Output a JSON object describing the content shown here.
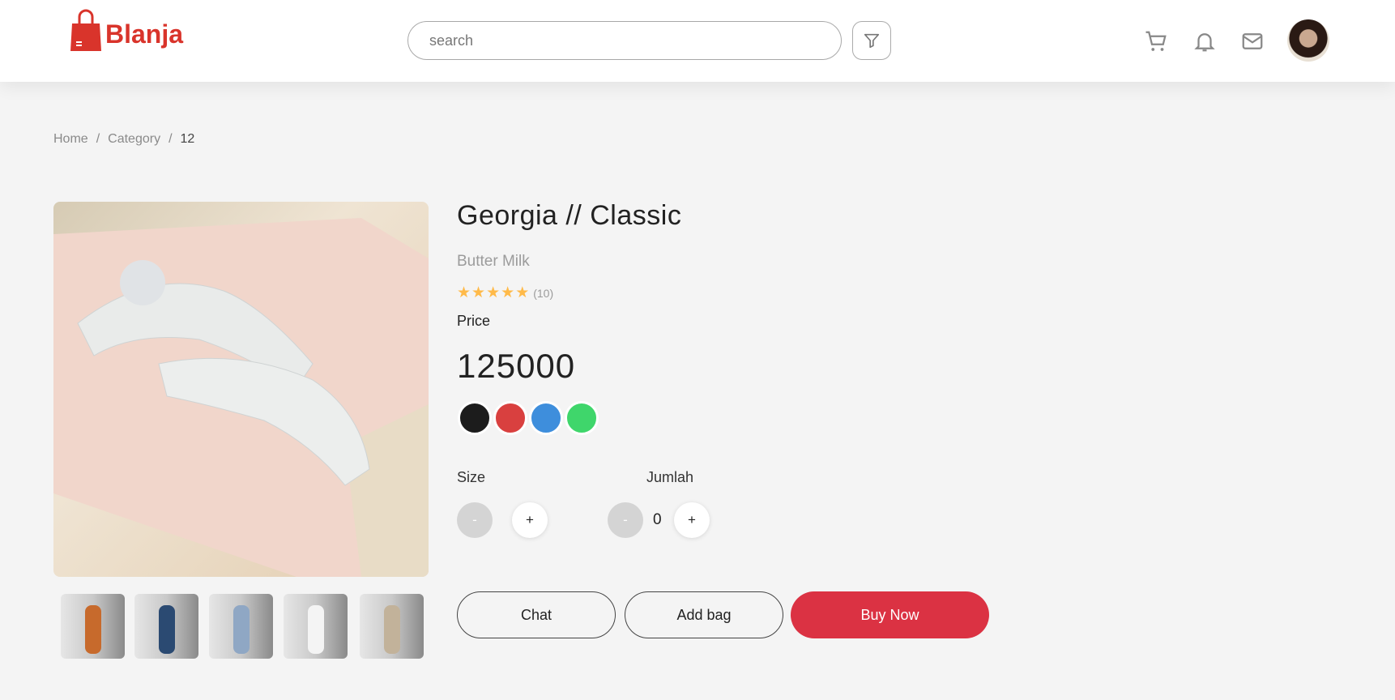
{
  "header": {
    "logo_text": "Blanja",
    "search_placeholder": "search",
    "brand_color": "#d9342b"
  },
  "breadcrumb": {
    "items": [
      "Home",
      "Category",
      "12"
    ],
    "separator": "/"
  },
  "product": {
    "title": "Georgia // Classic",
    "brand": "Butter Milk",
    "rating": 5,
    "rating_max": 5,
    "review_count": "(10)",
    "price_label": "Price",
    "price": "125000",
    "colors": [
      "#1c1c1c",
      "#d9403f",
      "#3e8edc",
      "#3fd66b"
    ],
    "size_label": "Size",
    "quantity_label": "Jumlah",
    "quantity": "0",
    "minus": "-",
    "plus": "+"
  },
  "actions": {
    "chat": "Chat",
    "add_bag": "Add bag",
    "buy_now": "Buy Now",
    "accent": "#db3243"
  }
}
